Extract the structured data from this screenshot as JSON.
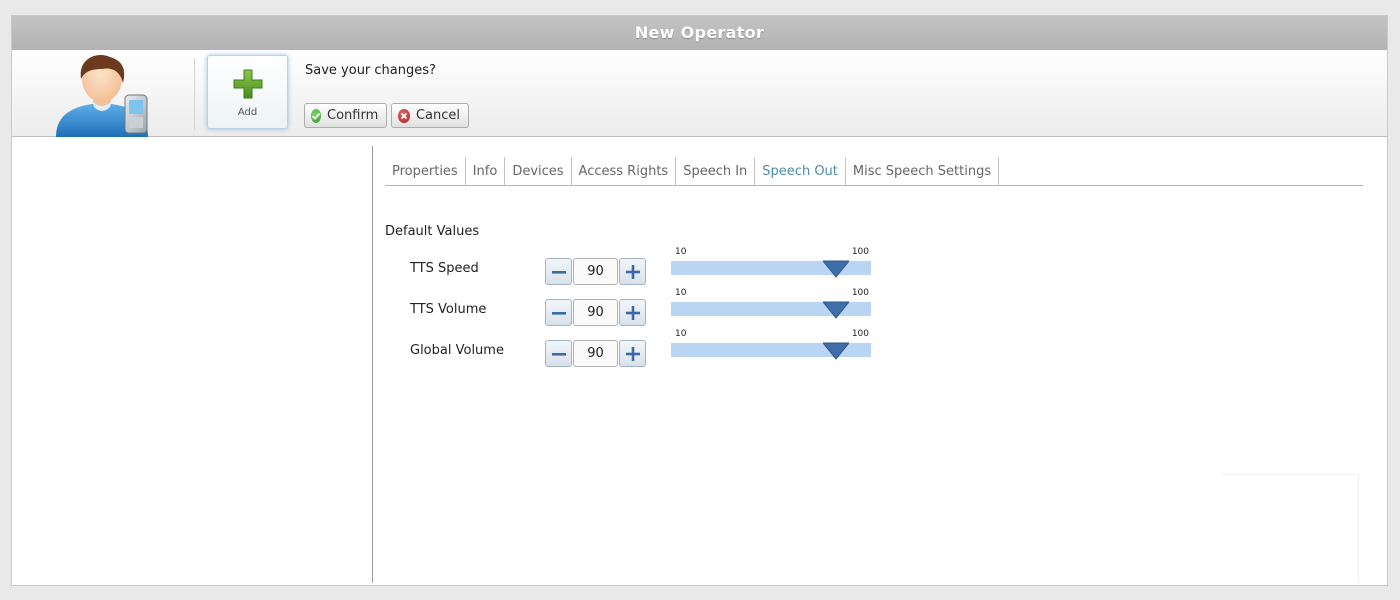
{
  "window": {
    "title": "New Operator"
  },
  "toolbar": {
    "add_label": "Add",
    "prompt": "Save your changes?",
    "confirm_label": "Confirm",
    "cancel_label": "Cancel"
  },
  "tabs": [
    {
      "label": "Properties"
    },
    {
      "label": "Info"
    },
    {
      "label": "Devices"
    },
    {
      "label": "Access Rights"
    },
    {
      "label": "Speech In"
    },
    {
      "label": "Speech Out",
      "active": true
    },
    {
      "label": "Misc Speech Settings"
    }
  ],
  "section": {
    "title": "Default Values"
  },
  "settings": [
    {
      "label": "TTS Speed",
      "value": "90",
      "min": "10",
      "max": "100",
      "fraction": 0.9
    },
    {
      "label": "TTS Volume",
      "value": "90",
      "min": "10",
      "max": "100",
      "fraction": 0.9
    },
    {
      "label": "Global Volume",
      "value": "90",
      "min": "10",
      "max": "100",
      "fraction": 0.9
    }
  ],
  "colors": {
    "active_tab": "#4c8aab",
    "slider_track": "#bad5f4",
    "slider_thumb": "#3f6ea8",
    "add_icon": "#5a9e2f"
  },
  "icons": {
    "avatar": "user-phone-avatar-icon",
    "add": "green-plus-icon",
    "confirm": "green-check-circle-icon",
    "cancel": "red-x-circle-icon",
    "decrement": "minus-icon",
    "increment": "plus-icon",
    "slider_thumb": "triangle-down-icon"
  }
}
